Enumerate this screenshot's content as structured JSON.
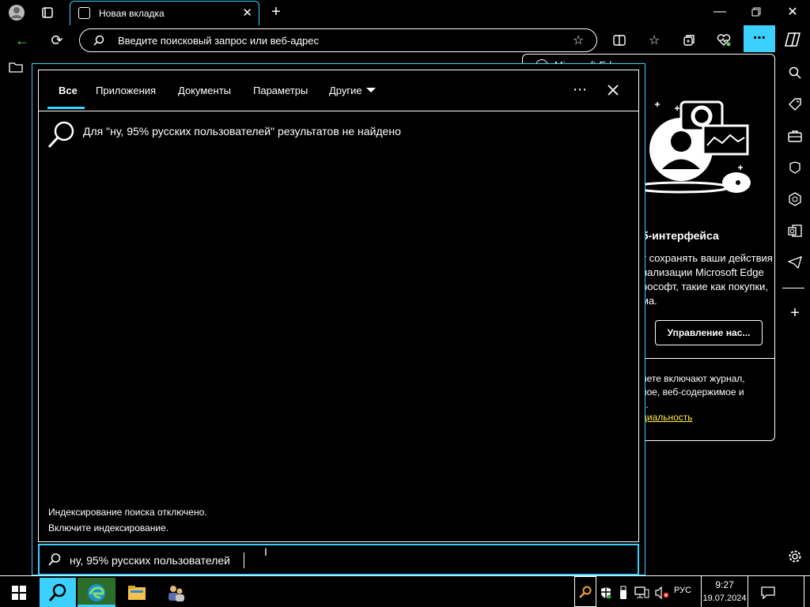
{
  "browser": {
    "tab_title": "Новая вкладка",
    "address_placeholder": "Введите поисковый запрос или веб-адрес"
  },
  "background_page": {
    "top_label": "Microsoft Ed",
    "heading": "б-интерфейса",
    "body_lines": [
      "т сохранять ваши действия",
      "нализации Microsoft Edge",
      "рософт, такие как покупки,",
      "ма."
    ],
    "button_label": "Управление нас...",
    "footer_lines": [
      "нете включают журнал,",
      "ное, веб-содержимое и",
      "к."
    ],
    "link_text": "циальность"
  },
  "search": {
    "tabs": [
      {
        "label": "Все"
      },
      {
        "label": "Приложения"
      },
      {
        "label": "Документы"
      },
      {
        "label": "Параметры"
      },
      {
        "label": "Другие"
      }
    ],
    "no_results": "Для \"ну, 95% русских пользователей\" результатов не найдено",
    "index_line1": "Индексирование поиска отключено.",
    "index_line2": "Включите индексирование.",
    "query": "ну, 95% русских пользователей"
  },
  "taskbar": {
    "lang": "РУС",
    "time": "9:27",
    "date": "19.07.2024"
  },
  "colors": {
    "accent": "#3cd0ff",
    "background": "#000000",
    "text": "#ffffff"
  }
}
